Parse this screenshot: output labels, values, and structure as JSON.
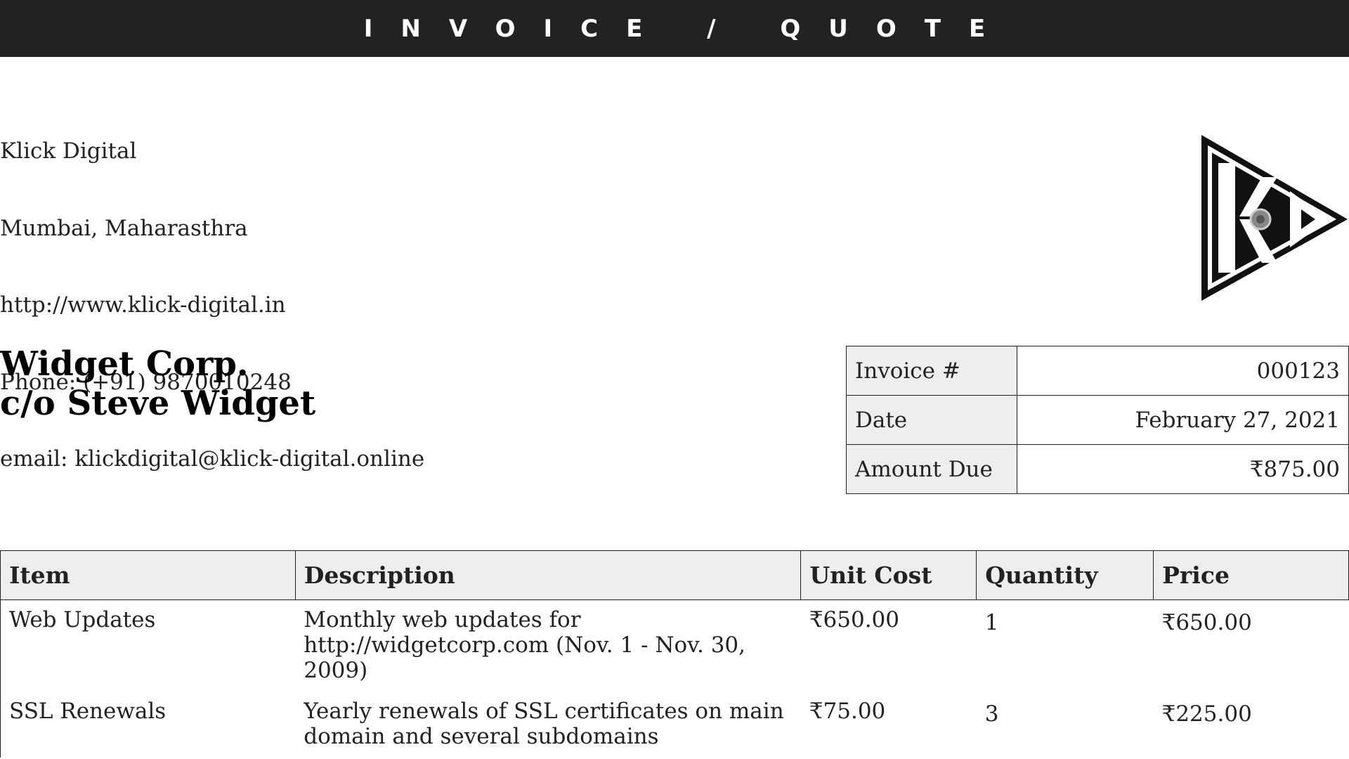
{
  "header": {
    "title": "INVOICE / QUOTE"
  },
  "company": {
    "name": "Klick Digital",
    "location": "Mumbai, Maharasthra",
    "website": "http://www.klick-digital.in",
    "phone": "Phone: (+91) 9870010248",
    "email": "email: klickdigital@klick-digital.online",
    "logo_text": "KD"
  },
  "customer": {
    "line1": "Widget Corp.",
    "line2": "c/o Steve Widget"
  },
  "meta": {
    "invoice_label": "Invoice #",
    "invoice_value": "000123",
    "date_label": "Date",
    "date_value": "February 27, 2021",
    "amount_label": "Amount Due",
    "amount_value": "₹875.00"
  },
  "items": {
    "headers": [
      "Item",
      "Description",
      "Unit Cost",
      "Quantity",
      "Price"
    ],
    "rows": [
      {
        "item": "Web Updates",
        "description": "Monthly web updates for http://widgetcorp.com (Nov. 1 - Nov. 30, 2009)",
        "unit_cost": "₹650.00",
        "quantity": "1",
        "price": "₹650.00"
      },
      {
        "item": "SSL Renewals",
        "description": "Yearly renewals of SSL certificates on main domain and several subdomains",
        "unit_cost": "₹75.00",
        "quantity": "3",
        "price": "₹225.00"
      }
    ]
  },
  "colors": {
    "header_bg": "#222222",
    "header_text": "#ffffff",
    "cell_bg": "#eeeeee"
  }
}
